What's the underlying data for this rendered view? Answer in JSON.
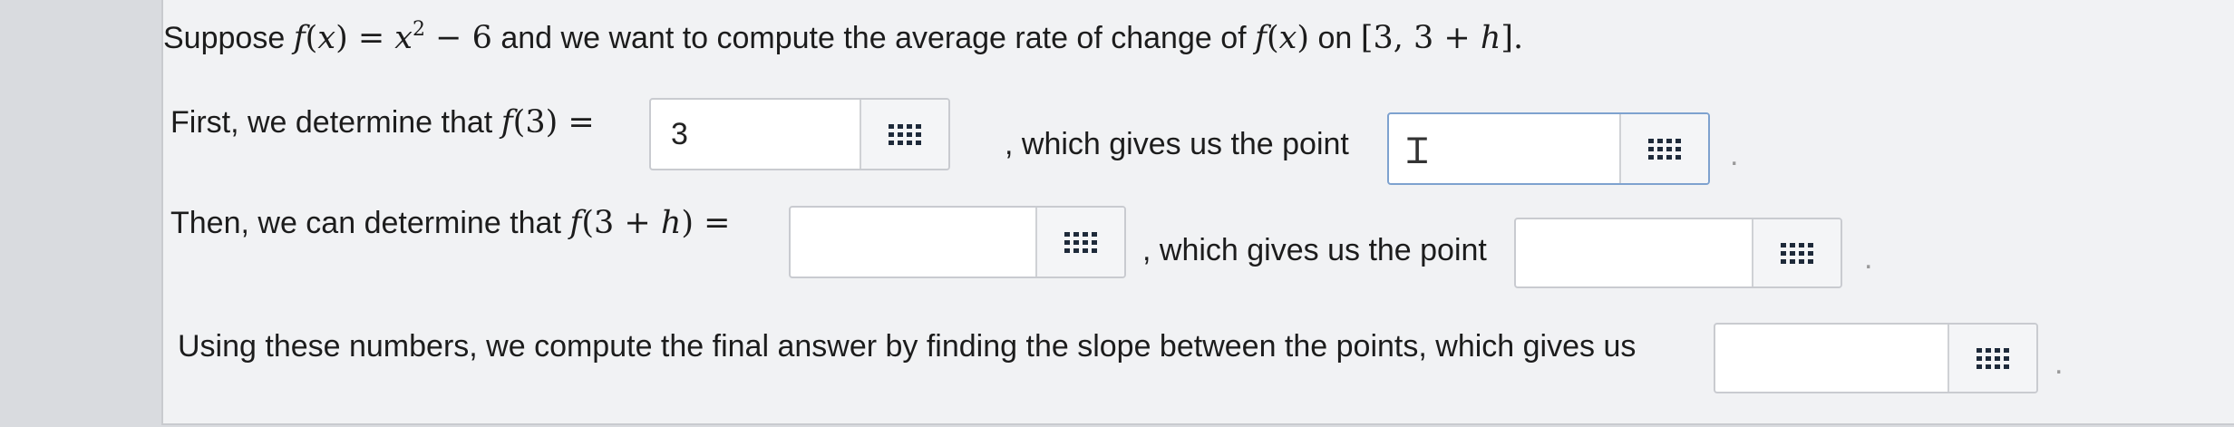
{
  "question": {
    "intro": "Suppose",
    "func_def_f": "f",
    "func_def_x": "x",
    "func_def_rest": " = x",
    "exponent": "2",
    "func_def_tail": " − 6",
    "intro_middle": "and we want to compute the average rate of change of",
    "interval": "[3, 3 + h]."
  },
  "step1": {
    "text_before": "First, we determine that",
    "math": "f(3) =",
    "input_value": "3",
    "text_after": ", which gives us the point",
    "point_input_value": ""
  },
  "step2": {
    "text_before": "Then, we can determine that",
    "math": "f(3 + h) =",
    "input_value": "",
    "text_after": ", which gives us the point",
    "point_input_value": ""
  },
  "step3": {
    "text": "Using these numbers, we compute the final answer by finding the slope between the points, which gives us",
    "input_value": ""
  },
  "icons": {
    "palette": "math-palette-icon",
    "cursor": "text-cursor-icon"
  },
  "colors": {
    "background": "#f1f2f4",
    "input_border": "#c9cbd0",
    "active_border": "#7ea2cf"
  }
}
